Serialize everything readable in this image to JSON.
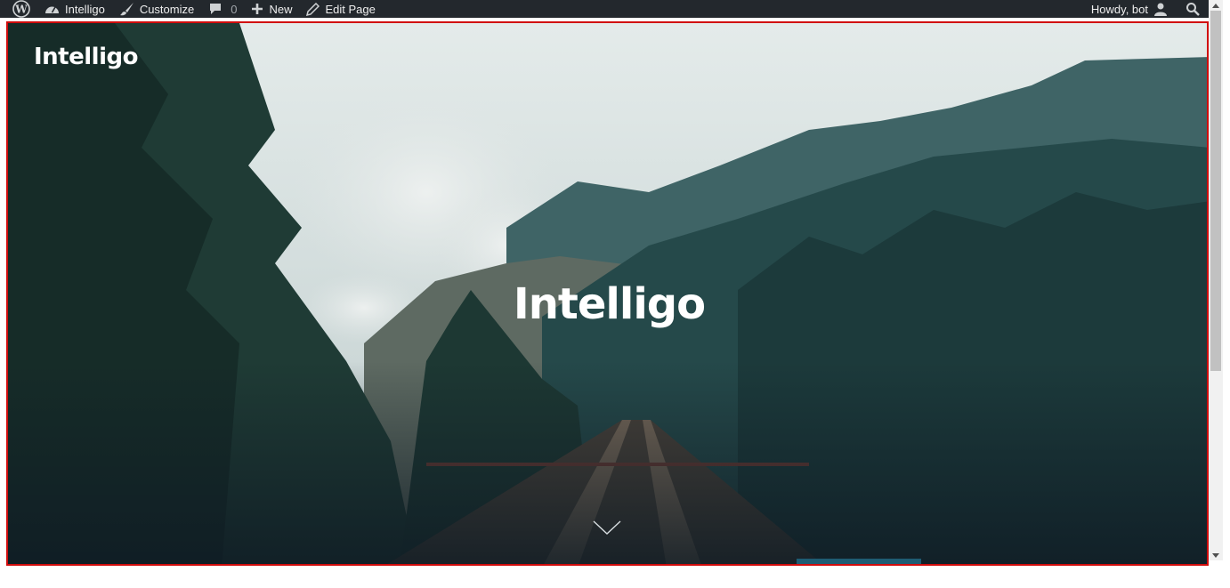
{
  "admin_bar": {
    "site_name": "Intelligo",
    "customize_label": "Customize",
    "comments_count": "0",
    "new_label": "New",
    "edit_page_label": "Edit Page",
    "greeting": "Howdy, bot"
  },
  "header": {
    "site_title": "Intelligo"
  },
  "hero": {
    "title": "Intelligo"
  },
  "icons": {
    "wordpress": "wordpress-logo-icon",
    "dashboard": "dashboard-icon",
    "customize": "paintbrush-icon",
    "comments": "comment-bubble-icon",
    "new": "plus-icon",
    "edit": "pencil-icon",
    "user": "user-avatar-icon",
    "search": "search-icon",
    "scroll": "chevron-down-icon"
  },
  "colors": {
    "admin_bar_bg": "#23282d",
    "frame_border": "#d10c0c",
    "accent_bar": "#1e5c73"
  }
}
